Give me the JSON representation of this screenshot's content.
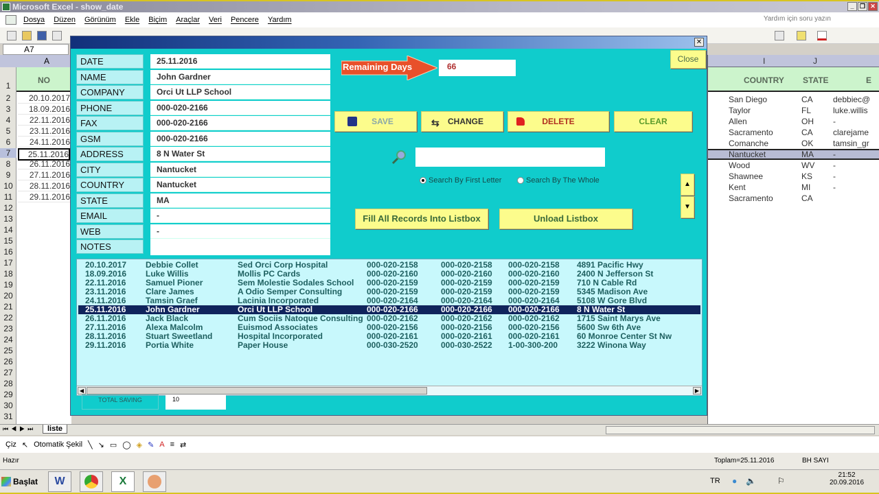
{
  "window": {
    "title": "Microsoft Excel - show_date"
  },
  "menu": {
    "items": [
      "Dosya",
      "Düzen",
      "Görünüm",
      "Ekle",
      "Biçim",
      "Araçlar",
      "Veri",
      "Pencere",
      "Yardım"
    ],
    "help_placeholder": "Yardım için soru yazın"
  },
  "namebox": {
    "value": "A7"
  },
  "sheet_left": {
    "column": "A",
    "header": "NO",
    "row_numbers": [
      "1",
      "2",
      "3",
      "4",
      "5",
      "6",
      "7",
      "8",
      "9",
      "10",
      "11",
      "12",
      "13",
      "14",
      "15",
      "16",
      "17",
      "18",
      "19",
      "20",
      "21",
      "22",
      "23",
      "24",
      "25",
      "26",
      "27",
      "28",
      "29",
      "30",
      "31"
    ],
    "values": [
      "20.10.2017",
      "18.09.2016",
      "22.11.2016",
      "23.11.2016",
      "24.11.2016",
      "25.11.2016",
      "26.11.2016",
      "27.11.2016",
      "28.11.2016",
      "29.11.2016"
    ]
  },
  "sheet_right": {
    "columns": [
      "I",
      "J",
      "E"
    ],
    "headers": [
      "COUNTRY",
      "STATE",
      "E"
    ],
    "rows": [
      [
        "San Diego",
        "CA",
        "debbiec@"
      ],
      [
        "Taylor",
        "FL",
        "luke.willis"
      ],
      [
        "Allen",
        "OH",
        "-"
      ],
      [
        "Sacramento",
        "CA",
        "clarejame"
      ],
      [
        "Comanche",
        "OK",
        "tamsin_gr"
      ],
      [
        "Nantucket",
        "MA",
        "-"
      ],
      [
        "Wood",
        "WV",
        "-"
      ],
      [
        "Shawnee",
        "KS",
        "-"
      ],
      [
        "Kent",
        "MI",
        "-"
      ],
      [
        "Sacramento",
        "CA",
        ""
      ]
    ]
  },
  "form": {
    "close_label": "Close",
    "fields": [
      {
        "label": "DATE",
        "value": "25.11.2016"
      },
      {
        "label": "NAME",
        "value": "John Gardner"
      },
      {
        "label": "COMPANY",
        "value": "Orci Ut LLP School"
      },
      {
        "label": "PHONE",
        "value": "000-020-2166"
      },
      {
        "label": "FAX",
        "value": "000-020-2166"
      },
      {
        "label": "GSM",
        "value": "000-020-2166"
      },
      {
        "label": "ADDRESS",
        "value": "8 N Water St"
      },
      {
        "label": "CITY",
        "value": "Nantucket"
      },
      {
        "label": "COUNTRY",
        "value": "Nantucket"
      },
      {
        "label": "STATE",
        "value": "MA"
      },
      {
        "label": "EMAIL",
        "value": "-"
      },
      {
        "label": "WEB",
        "value": "-"
      },
      {
        "label": "NOTES",
        "value": ""
      }
    ],
    "remaining_days_label": "Remaining Days",
    "remaining_days_value": "66",
    "buttons": {
      "save": "SAVE",
      "change": "CHANGE",
      "delete": "DELETE",
      "clear": "CLEAR",
      "fill": "Fill All Records Into Listbox",
      "unload": "Unload Listbox"
    },
    "search": {
      "value": "",
      "radio_first": "Search By First Letter",
      "radio_whole": "Search By The Whole",
      "selected": "first"
    },
    "listbox": {
      "selected_index": 5,
      "rows": [
        [
          "20.10.2017",
          "Debbie Collet",
          "Sed Orci Corp Hospital",
          "000-020-2158",
          "000-020-2158",
          "000-020-2158",
          "4891 Pacific Hwy"
        ],
        [
          "18.09.2016",
          "Luke Willis",
          "Mollis PC Cards",
          "000-020-2160",
          "000-020-2160",
          "000-020-2160",
          "2400 N Jefferson St"
        ],
        [
          "22.11.2016",
          "Samuel Pioner",
          "Sem Molestie Sodales School",
          "000-020-2159",
          "000-020-2159",
          "000-020-2159",
          "710 N Cable Rd"
        ],
        [
          "23.11.2016",
          "Clare James",
          "A Odio Semper Consulting",
          "000-020-2159",
          "000-020-2159",
          "000-020-2159",
          "5345 Madison Ave"
        ],
        [
          "24.11.2016",
          "Tamsin Graef",
          "Lacinia  Incorporated",
          "000-020-2164",
          "000-020-2164",
          "000-020-2164",
          "5108 W Gore Blvd"
        ],
        [
          "25.11.2016",
          "John Gardner",
          "Orci Ut LLP School",
          "000-020-2166",
          "000-020-2166",
          "000-020-2166",
          "8 N Water St"
        ],
        [
          "26.11.2016",
          "Jack Black",
          "Cum Sociis Natoque Consulting",
          "000-020-2162",
          "000-020-2162",
          "000-020-2162",
          "1715 Saint Marys Ave"
        ],
        [
          "27.11.2016",
          "Alexa Malcolm",
          "Euismod Associates",
          "000-020-2156",
          "000-020-2156",
          "000-020-2156",
          "5600 Sw 6th Ave"
        ],
        [
          "28.11.2016",
          "Stuart Sweetland",
          " Hospital Incorporated",
          "000-020-2161",
          "000-020-2161",
          "000-020-2161",
          "60 Monroe Center St Nw"
        ],
        [
          "29.11.2016",
          "Portia White",
          "Paper House",
          "000-030-2520",
          "000-030-2522",
          "1-00-300-200",
          "3222 Winona Way"
        ]
      ]
    },
    "total_saving_label": "TOTAL SAVING",
    "total_saving_value": "10"
  },
  "sheet_tab": "liste",
  "drawbar": {
    "draw": "Çiz",
    "autoshape": "Otomatik Şekil"
  },
  "status": {
    "ready": "Hazır",
    "sum": "Toplam=25.11.2016",
    "mode": "BH SAYI"
  },
  "taskbar": {
    "start": "Başlat",
    "lang": "TR",
    "time": "21:52",
    "date": "20.09.2016"
  },
  "colors": {
    "form_bg": "#10cccc",
    "button_yellow": "#fcfc8c",
    "selection": "#10245c",
    "arrow": "#e8502a"
  }
}
